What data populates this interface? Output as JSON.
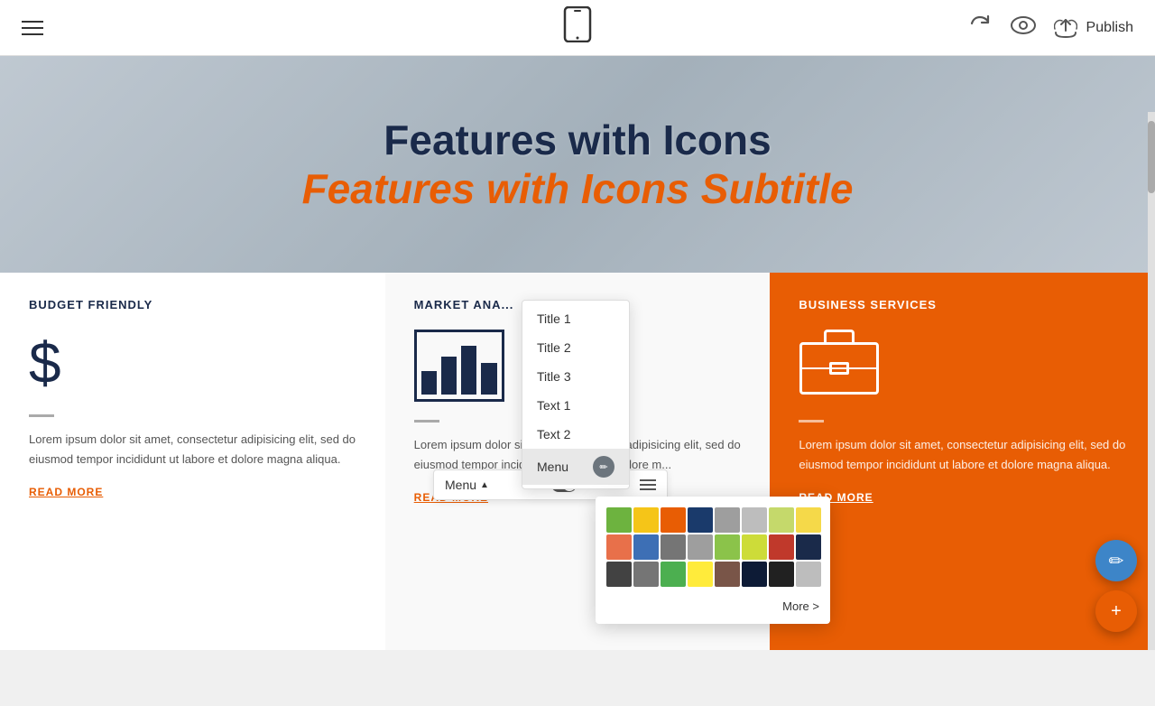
{
  "toolbar": {
    "publish_label": "Publish"
  },
  "hero": {
    "title": "Features with Icons",
    "subtitle": "Features with Icons Subtitle"
  },
  "cards": [
    {
      "title": "BUDGET FRIENDLY",
      "icon": "dollar",
      "text": "Lorem ipsum dolor sit amet, consectetur adipisicing elit, sed do eiusmod tempor incididunt ut labore et dolore magna aliqua.",
      "read_more": "READ MORE"
    },
    {
      "title": "MARKET ANA...",
      "icon": "chart",
      "text": "Lorem ipsum dolor sit amet, consectetur adipisicing elit, sed do eiusmod tempor incididunt ut labore et dolore m...",
      "read_more": "READ MORE"
    },
    {
      "title": "BUSINESS SERVICES",
      "icon": "briefcase",
      "text": "Lorem ipsum dolor sit amet, consectetur adipisicing elit, sed do eiusmod tempor incididunt ut labore et dolore magna aliqua.",
      "read_more": "READ MORE"
    }
  ],
  "context_menu": {
    "items": [
      {
        "label": "Title 1"
      },
      {
        "label": "Title 2"
      },
      {
        "label": "Title 3"
      },
      {
        "label": "Text 1"
      },
      {
        "label": "Text 2"
      },
      {
        "label": "Menu"
      }
    ]
  },
  "menu_bar": {
    "label": "Menu",
    "more_label": "More >"
  },
  "color_palette": {
    "colors": [
      "#6db33f",
      "#f5c518",
      "#e85d04",
      "#1a3a6b",
      "#9e9e9e",
      "#bdbdbd",
      "#c5d96b",
      "#f5d949",
      "#e8704a",
      "#3d6fb5",
      "#757575",
      "#9e9e9e",
      "#8bc34a",
      "#cddc39",
      "#c0392b",
      "#1a2a4a",
      "#424242",
      "#757575",
      "#4caf50",
      "#ffeb3b",
      "#795548",
      "#0d1b36",
      "#212121",
      "#bdbdbd"
    ]
  }
}
